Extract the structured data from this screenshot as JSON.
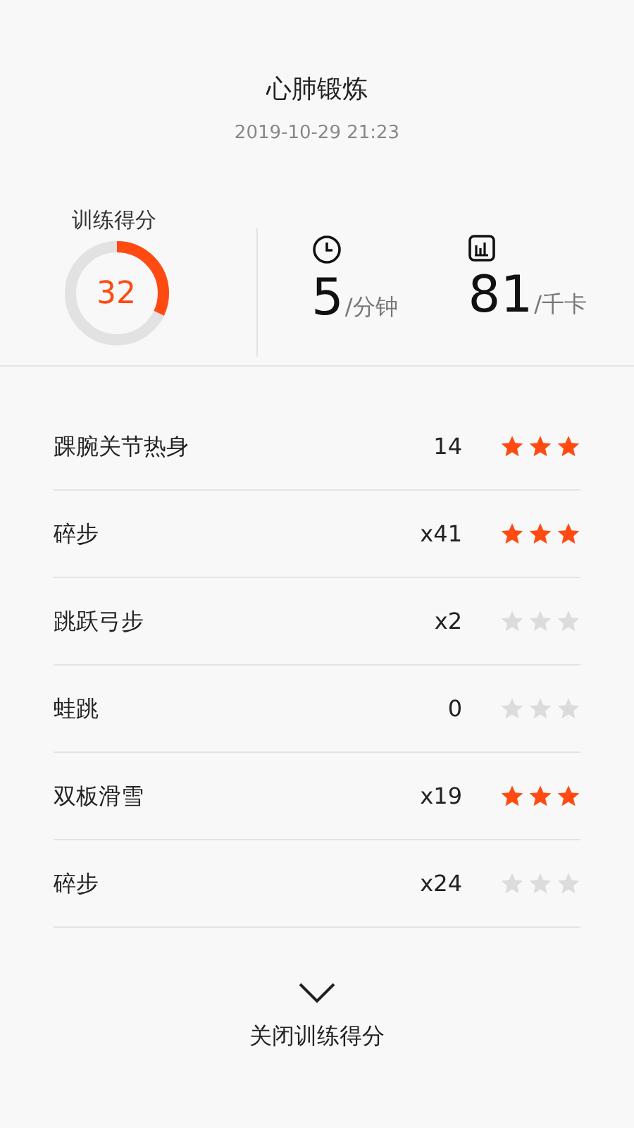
{
  "title": "心肺锻炼",
  "datetime": "2019-10-29 21:23",
  "score": {
    "label": "训练得分",
    "value": "32",
    "level": 0.32
  },
  "stats": [
    {
      "kind": "time",
      "value": "5",
      "unit": "/分钟"
    },
    {
      "kind": "calories",
      "value": "81",
      "unit": "/千卡"
    }
  ],
  "exercises": [
    {
      "name": "踝腕关节热身",
      "count": "14",
      "stars": 3
    },
    {
      "name": "碎步",
      "count": "x41",
      "stars": 3
    },
    {
      "name": "跳跃弓步",
      "count": "x2",
      "stars": 0
    },
    {
      "name": "蛙跳",
      "count": "0",
      "stars": 0
    },
    {
      "name": "双板滑雪",
      "count": "x19",
      "stars": 3
    },
    {
      "name": "碎步",
      "count": "x24",
      "stars": 0
    }
  ],
  "close_label": "关闭训练得分"
}
